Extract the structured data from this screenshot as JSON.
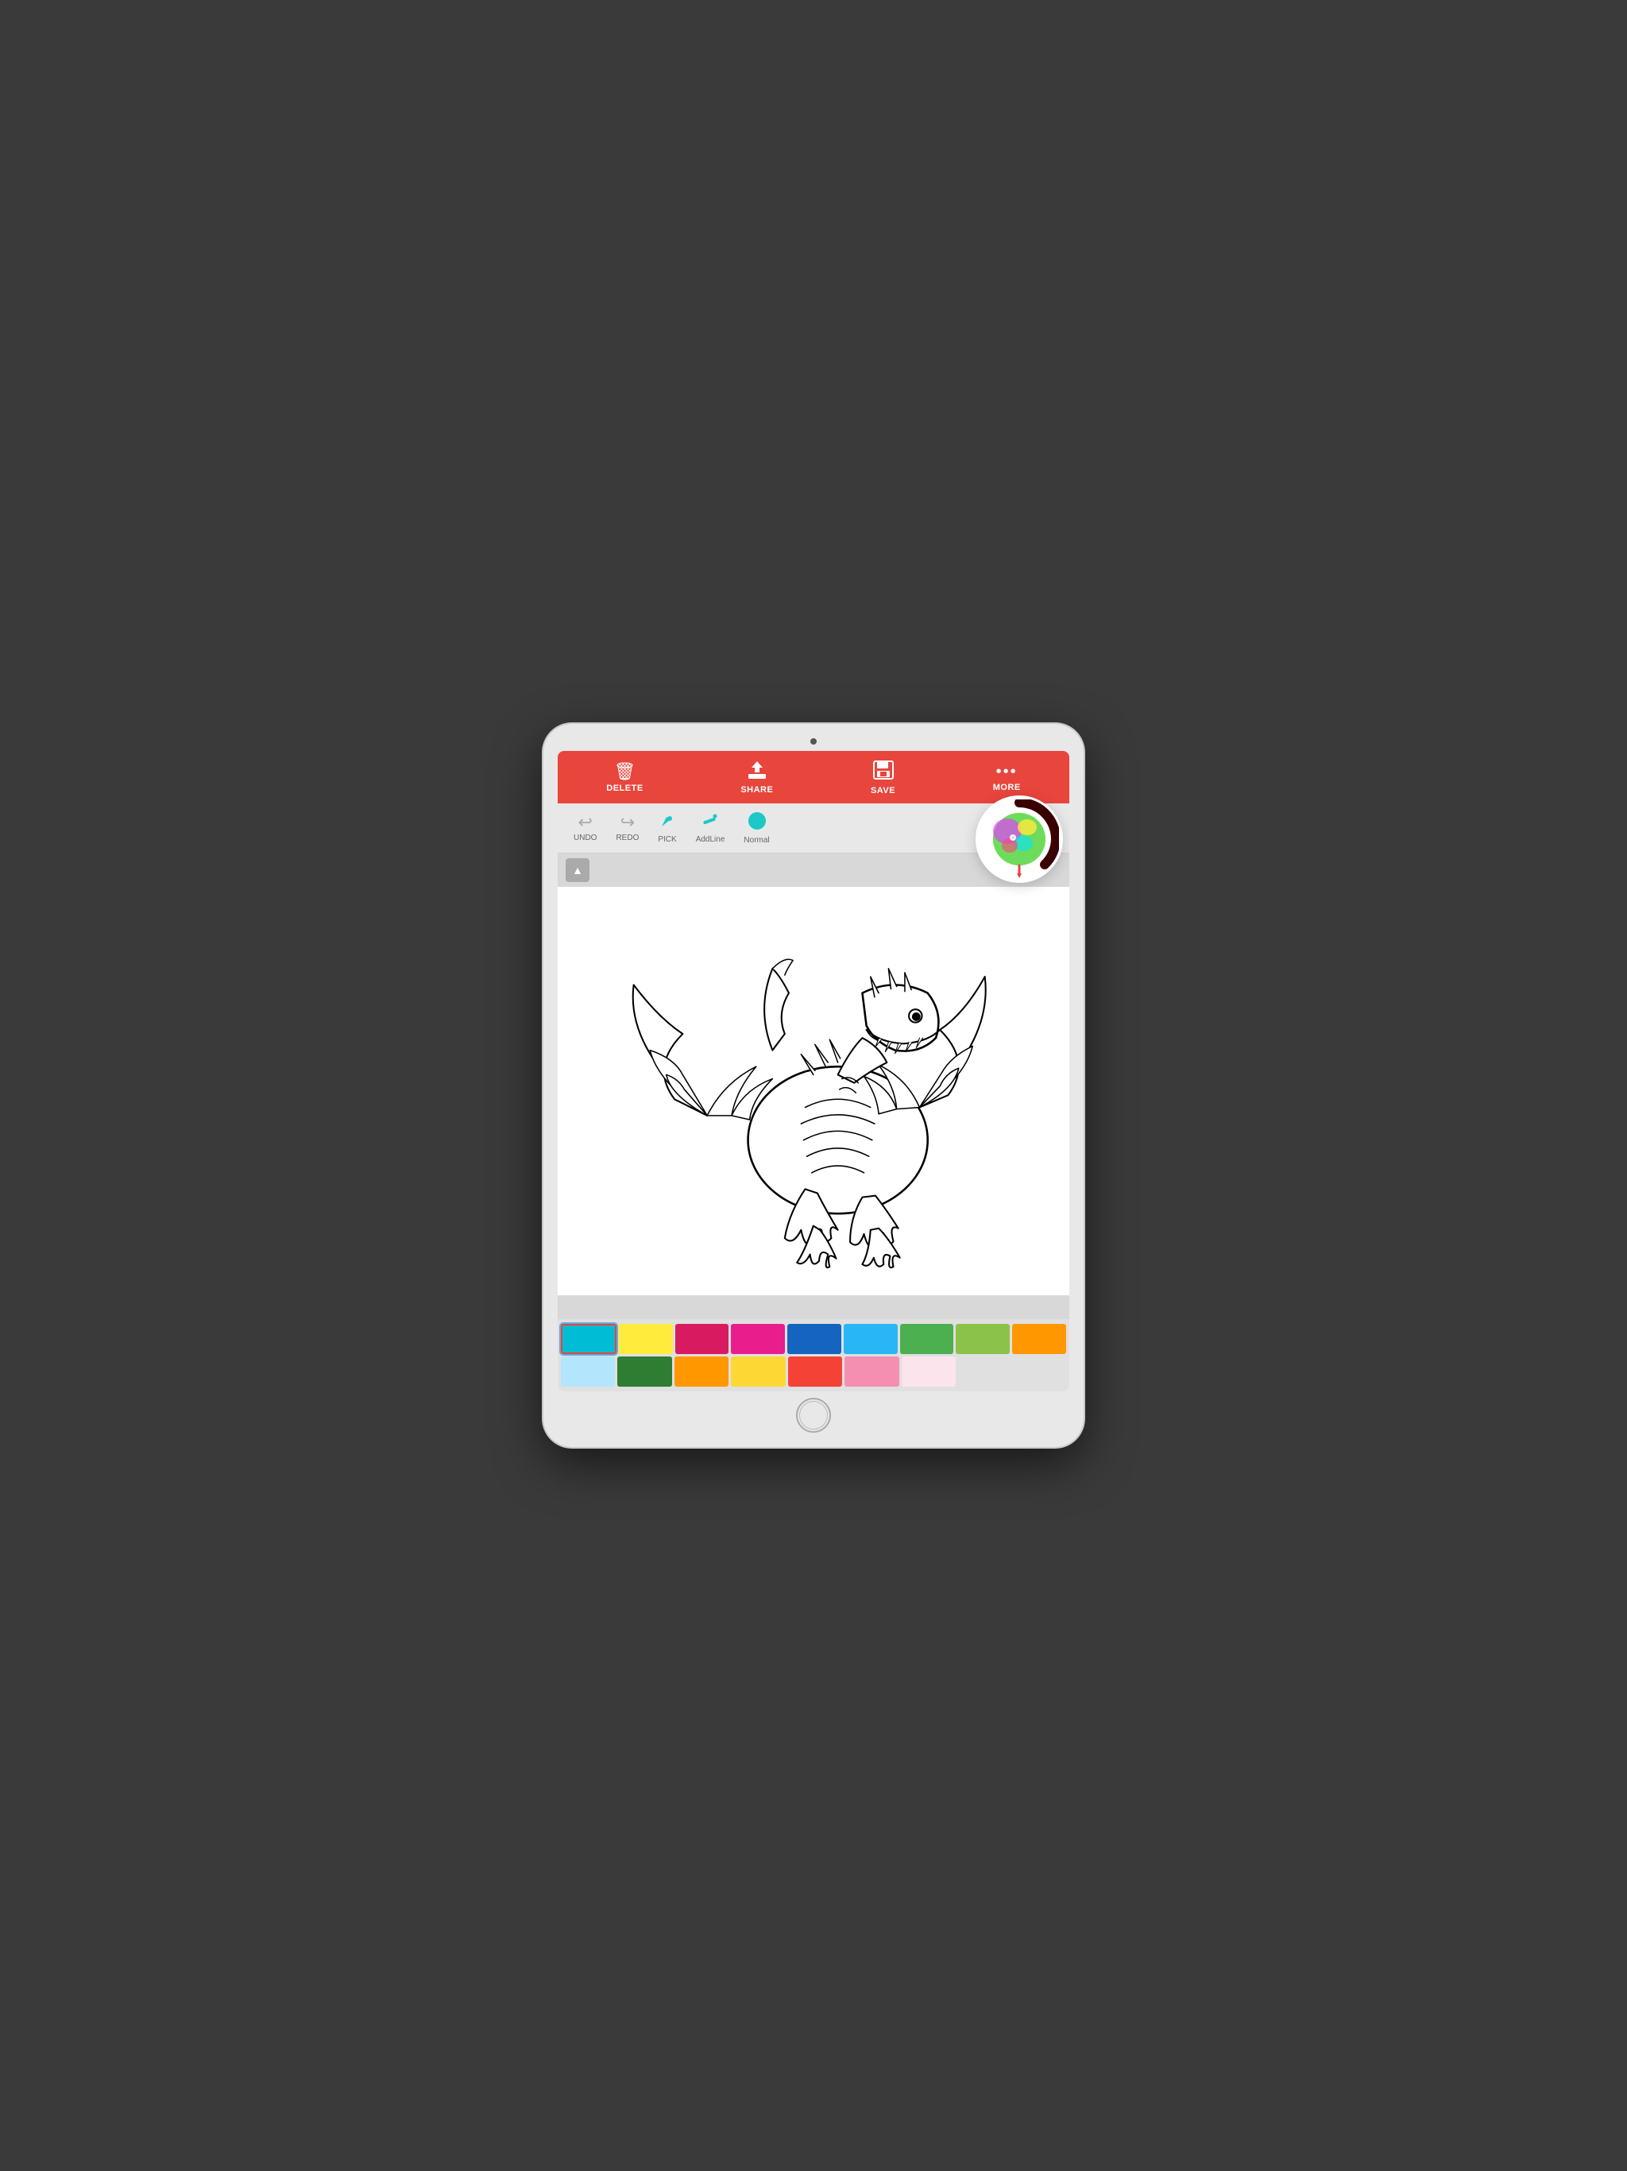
{
  "toolbar": {
    "delete_label": "DELETE",
    "share_label": "SHARE",
    "save_label": "SAVE",
    "more_label": "MORE"
  },
  "tools": {
    "undo_label": "UNDO",
    "redo_label": "REDO",
    "pick_label": "PICK",
    "addline_label": "AddLine",
    "normal_label": "Normal"
  },
  "palette": {
    "row1": [
      "#00bcd4",
      "#ffeb3b",
      "#e91e8c",
      "#e91e8c",
      "#1565c0",
      "#29b6f6",
      "#4caf50",
      "#8bc34a",
      "#ff9800"
    ],
    "row2": [
      "#b3e5fc",
      "#2e7d32",
      "#ff9800",
      "#fdd835",
      "#f44336",
      "#f48fb1",
      "#fce4ec"
    ]
  },
  "accent_color": "#e8453c"
}
